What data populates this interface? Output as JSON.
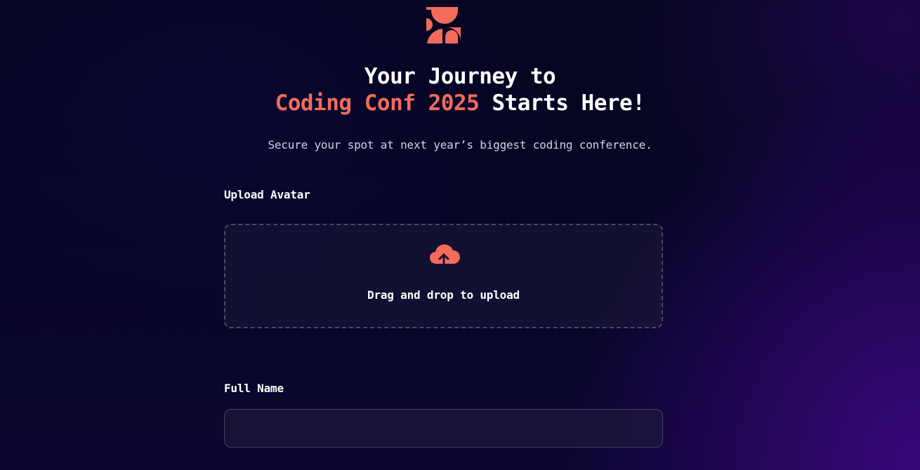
{
  "header": {
    "logo_icon": "conference-logo-icon",
    "title_line1": "Your Journey to",
    "title_accent": "Coding Conf 2025",
    "title_rest": " Starts Here!",
    "subtitle": "Secure your spot at next year’s biggest coding conference."
  },
  "form": {
    "avatar_label": "Upload Avatar",
    "upload_icon": "cloud-upload-icon",
    "upload_text": "Drag and drop to upload",
    "full_name_label": "Full Name",
    "full_name_value": ""
  },
  "colors": {
    "accent": "#f36b5b",
    "background": "#070526",
    "background_glow": "#3a087d",
    "text": "#ffffff",
    "muted_text": "#d4d1e4",
    "border": "#4b4a66"
  }
}
